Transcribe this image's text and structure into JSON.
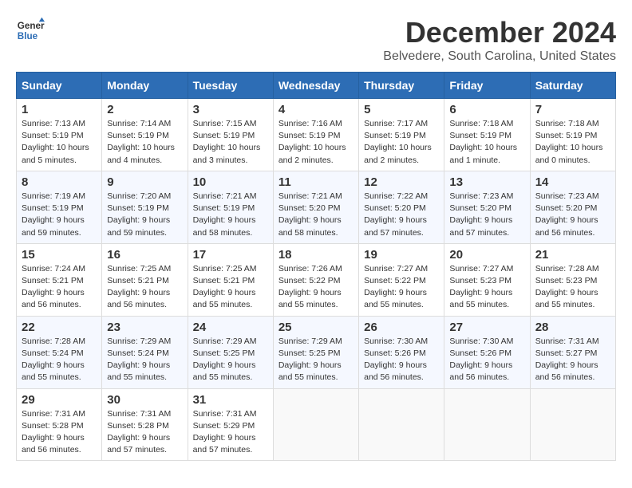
{
  "logo": {
    "line1": "General",
    "line2": "Blue"
  },
  "title": "December 2024",
  "location": "Belvedere, South Carolina, United States",
  "days_of_week": [
    "Sunday",
    "Monday",
    "Tuesday",
    "Wednesday",
    "Thursday",
    "Friday",
    "Saturday"
  ],
  "weeks": [
    [
      {
        "day": "1",
        "info": "Sunrise: 7:13 AM\nSunset: 5:19 PM\nDaylight: 10 hours\nand 5 minutes."
      },
      {
        "day": "2",
        "info": "Sunrise: 7:14 AM\nSunset: 5:19 PM\nDaylight: 10 hours\nand 4 minutes."
      },
      {
        "day": "3",
        "info": "Sunrise: 7:15 AM\nSunset: 5:19 PM\nDaylight: 10 hours\nand 3 minutes."
      },
      {
        "day": "4",
        "info": "Sunrise: 7:16 AM\nSunset: 5:19 PM\nDaylight: 10 hours\nand 2 minutes."
      },
      {
        "day": "5",
        "info": "Sunrise: 7:17 AM\nSunset: 5:19 PM\nDaylight: 10 hours\nand 2 minutes."
      },
      {
        "day": "6",
        "info": "Sunrise: 7:18 AM\nSunset: 5:19 PM\nDaylight: 10 hours\nand 1 minute."
      },
      {
        "day": "7",
        "info": "Sunrise: 7:18 AM\nSunset: 5:19 PM\nDaylight: 10 hours\nand 0 minutes."
      }
    ],
    [
      {
        "day": "8",
        "info": "Sunrise: 7:19 AM\nSunset: 5:19 PM\nDaylight: 9 hours\nand 59 minutes."
      },
      {
        "day": "9",
        "info": "Sunrise: 7:20 AM\nSunset: 5:19 PM\nDaylight: 9 hours\nand 59 minutes."
      },
      {
        "day": "10",
        "info": "Sunrise: 7:21 AM\nSunset: 5:19 PM\nDaylight: 9 hours\nand 58 minutes."
      },
      {
        "day": "11",
        "info": "Sunrise: 7:21 AM\nSunset: 5:20 PM\nDaylight: 9 hours\nand 58 minutes."
      },
      {
        "day": "12",
        "info": "Sunrise: 7:22 AM\nSunset: 5:20 PM\nDaylight: 9 hours\nand 57 minutes."
      },
      {
        "day": "13",
        "info": "Sunrise: 7:23 AM\nSunset: 5:20 PM\nDaylight: 9 hours\nand 57 minutes."
      },
      {
        "day": "14",
        "info": "Sunrise: 7:23 AM\nSunset: 5:20 PM\nDaylight: 9 hours\nand 56 minutes."
      }
    ],
    [
      {
        "day": "15",
        "info": "Sunrise: 7:24 AM\nSunset: 5:21 PM\nDaylight: 9 hours\nand 56 minutes."
      },
      {
        "day": "16",
        "info": "Sunrise: 7:25 AM\nSunset: 5:21 PM\nDaylight: 9 hours\nand 56 minutes."
      },
      {
        "day": "17",
        "info": "Sunrise: 7:25 AM\nSunset: 5:21 PM\nDaylight: 9 hours\nand 55 minutes."
      },
      {
        "day": "18",
        "info": "Sunrise: 7:26 AM\nSunset: 5:22 PM\nDaylight: 9 hours\nand 55 minutes."
      },
      {
        "day": "19",
        "info": "Sunrise: 7:27 AM\nSunset: 5:22 PM\nDaylight: 9 hours\nand 55 minutes."
      },
      {
        "day": "20",
        "info": "Sunrise: 7:27 AM\nSunset: 5:23 PM\nDaylight: 9 hours\nand 55 minutes."
      },
      {
        "day": "21",
        "info": "Sunrise: 7:28 AM\nSunset: 5:23 PM\nDaylight: 9 hours\nand 55 minutes."
      }
    ],
    [
      {
        "day": "22",
        "info": "Sunrise: 7:28 AM\nSunset: 5:24 PM\nDaylight: 9 hours\nand 55 minutes."
      },
      {
        "day": "23",
        "info": "Sunrise: 7:29 AM\nSunset: 5:24 PM\nDaylight: 9 hours\nand 55 minutes."
      },
      {
        "day": "24",
        "info": "Sunrise: 7:29 AM\nSunset: 5:25 PM\nDaylight: 9 hours\nand 55 minutes."
      },
      {
        "day": "25",
        "info": "Sunrise: 7:29 AM\nSunset: 5:25 PM\nDaylight: 9 hours\nand 55 minutes."
      },
      {
        "day": "26",
        "info": "Sunrise: 7:30 AM\nSunset: 5:26 PM\nDaylight: 9 hours\nand 56 minutes."
      },
      {
        "day": "27",
        "info": "Sunrise: 7:30 AM\nSunset: 5:26 PM\nDaylight: 9 hours\nand 56 minutes."
      },
      {
        "day": "28",
        "info": "Sunrise: 7:31 AM\nSunset: 5:27 PM\nDaylight: 9 hours\nand 56 minutes."
      }
    ],
    [
      {
        "day": "29",
        "info": "Sunrise: 7:31 AM\nSunset: 5:28 PM\nDaylight: 9 hours\nand 56 minutes."
      },
      {
        "day": "30",
        "info": "Sunrise: 7:31 AM\nSunset: 5:28 PM\nDaylight: 9 hours\nand 57 minutes."
      },
      {
        "day": "31",
        "info": "Sunrise: 7:31 AM\nSunset: 5:29 PM\nDaylight: 9 hours\nand 57 minutes."
      },
      null,
      null,
      null,
      null
    ]
  ]
}
